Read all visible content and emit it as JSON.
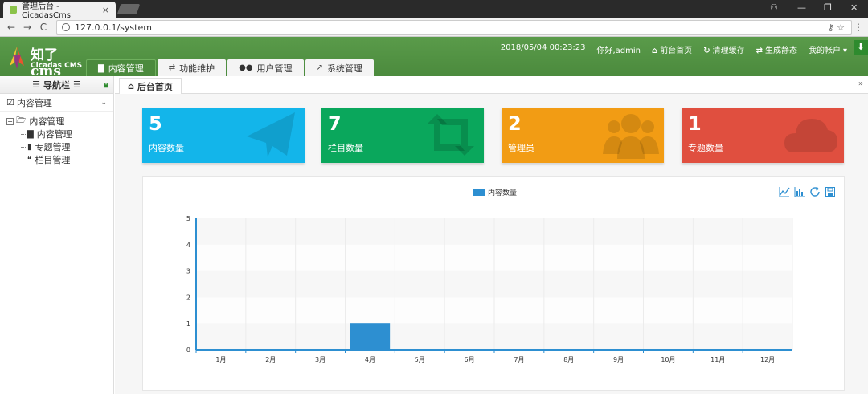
{
  "browser": {
    "tab_title": "管理后台 - CicadasCms",
    "tab_close": "×",
    "url": "127.0.0.1/system",
    "back": "←",
    "forward": "→",
    "reload": "C",
    "window_controls": [
      "⚇",
      "—",
      "❐",
      "✕"
    ]
  },
  "header": {
    "logo_title": "知了cms",
    "logo_sub": "Cicadas CMS",
    "tabs": [
      {
        "label": "内容管理",
        "icon": "document-icon",
        "active": true
      },
      {
        "label": "功能维护",
        "icon": "retweet-icon",
        "active": false
      },
      {
        "label": "用户管理",
        "icon": "users-icon",
        "active": false
      },
      {
        "label": "系统管理",
        "icon": "line-chart-icon",
        "active": false
      }
    ],
    "datetime": "2018/05/04 00:23:23",
    "greeting": "你好,admin",
    "links": [
      {
        "label": "前台首页",
        "icon": "home-icon"
      },
      {
        "label": "清理缓存",
        "icon": "refresh-icon"
      },
      {
        "label": "生成静态",
        "icon": "exchange-icon"
      },
      {
        "label": "我的帐户",
        "icon": "caret-down-icon"
      }
    ]
  },
  "sidebar": {
    "title": "导航栏",
    "section": "内容管理",
    "tree_root": "内容管理",
    "tree_children": [
      {
        "label": "内容管理",
        "icon": "file-icon"
      },
      {
        "label": "专题管理",
        "icon": "bookmark-icon"
      },
      {
        "label": "栏目管理",
        "icon": "quote-icon"
      }
    ]
  },
  "breadcrumb": {
    "label": "后台首页"
  },
  "cards": [
    {
      "value": "5",
      "label": "内容数量",
      "color": "#13b5ea",
      "icon": "paper-plane-icon"
    },
    {
      "value": "7",
      "label": "栏目数量",
      "color": "#0aa75c",
      "icon": "retweet-icon"
    },
    {
      "value": "2",
      "label": "管理员",
      "color": "#f29c14",
      "icon": "users-icon"
    },
    {
      "value": "1",
      "label": "专题数量",
      "color": "#e04f3f",
      "icon": "cloud-icon"
    }
  ],
  "chart_data": {
    "type": "bar",
    "categories": [
      "1月",
      "2月",
      "3月",
      "4月",
      "5月",
      "6月",
      "7月",
      "8月",
      "9月",
      "10月",
      "11月",
      "12月"
    ],
    "series": [
      {
        "name": "内容数量",
        "values": [
          0,
          0,
          0,
          1,
          0,
          0,
          0,
          0,
          0,
          0,
          0,
          0
        ],
        "color": "#2d8fd1"
      }
    ],
    "ylim": [
      0,
      5
    ],
    "yticks": [
      0,
      1,
      2,
      3,
      4,
      5
    ],
    "grid": true,
    "legend": "top-center",
    "toolbox": [
      "line-chart-icon",
      "bar-chart-icon",
      "restore-icon",
      "save-icon"
    ]
  }
}
